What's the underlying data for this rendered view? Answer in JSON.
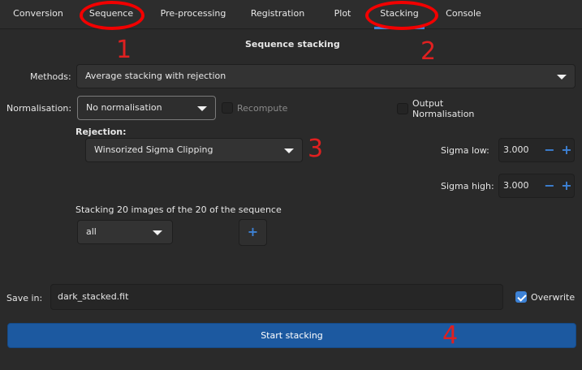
{
  "tabs": [
    "Conversion",
    "Sequence",
    "Pre-processing",
    "Registration",
    "Plot",
    "Stacking",
    "Console"
  ],
  "active_tab": "Stacking",
  "section_title": "Sequence stacking",
  "methods": {
    "label": "Methods:",
    "value": "Average stacking with rejection"
  },
  "normalisation": {
    "label": "Normalisation:",
    "value": "No normalisation",
    "recompute_label": "Recompute",
    "recompute_checked": false
  },
  "output_normalisation": {
    "line1": "Output",
    "line2": "Normalisation",
    "checked": false
  },
  "rejection": {
    "label": "Rejection:",
    "value": "Winsorized Sigma Clipping"
  },
  "sigma_low": {
    "label": "Sigma low:",
    "value": "3.000"
  },
  "sigma_high": {
    "label": "Sigma high:",
    "value": "3.000"
  },
  "stacking_info": "Stacking 20 images of the 20 of the sequence",
  "filter": {
    "value": "all"
  },
  "save": {
    "label": "Save in:",
    "value": "dark_stacked.fit",
    "overwrite_label": "Overwrite",
    "overwrite_checked": true
  },
  "start_button": "Start stacking",
  "annotations": [
    "1",
    "2",
    "3",
    "4"
  ],
  "colors": {
    "accent": "#3d82d6",
    "start_button": "#1c59a0",
    "annotation": "#e02020"
  }
}
